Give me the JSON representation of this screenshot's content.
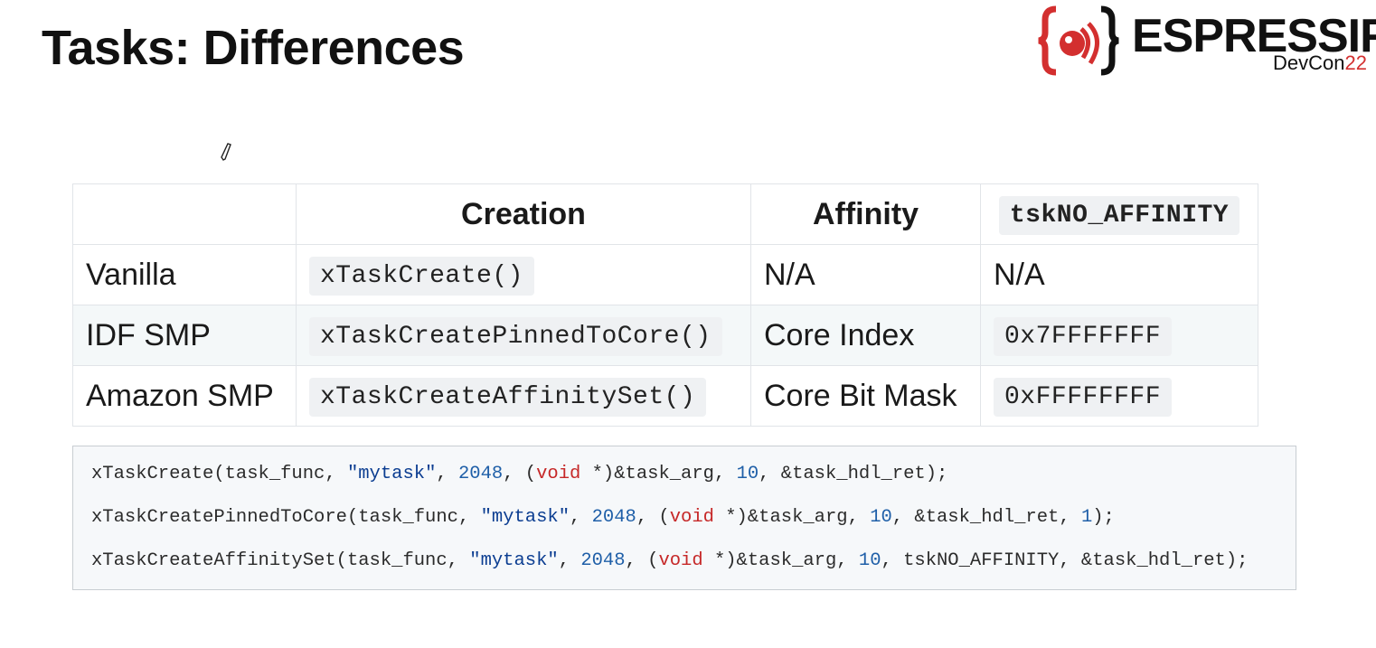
{
  "slide": {
    "title": "Tasks: Differences"
  },
  "logo": {
    "name": "ESPRESSIF",
    "event": "DevCon",
    "year": "22"
  },
  "table": {
    "headers": [
      "",
      "Creation",
      "Affinity",
      "tskNO_AFFINITY"
    ],
    "rows": [
      {
        "label": "Vanilla",
        "creation": "xTaskCreate()",
        "affinity": "N/A",
        "no_affinity": "N/A"
      },
      {
        "label": "IDF SMP",
        "creation": "xTaskCreatePinnedToCore()",
        "affinity": "Core Index",
        "no_affinity": "0x7FFFFFFF"
      },
      {
        "label": "Amazon SMP",
        "creation": "xTaskCreateAffinitySet()",
        "affinity": "Core Bit Mask",
        "no_affinity": "0xFFFFFFFF"
      }
    ]
  },
  "code": {
    "line1": {
      "fn": "xTaskCreate(task_func, ",
      "str": "\"mytask\"",
      "sep1": ", ",
      "n1": "2048",
      "sep2": ", (",
      "kw": "void",
      "sep3": " *)&task_arg, ",
      "n2": "10",
      "tail": ", &task_hdl_ret);"
    },
    "line2": {
      "fn": "xTaskCreatePinnedToCore(task_func, ",
      "str": "\"mytask\"",
      "sep1": ", ",
      "n1": "2048",
      "sep2": ", (",
      "kw": "void",
      "sep3": " *)&task_arg, ",
      "n2": "10",
      "mid": ", &task_hdl_ret, ",
      "n3": "1",
      "tail": ");"
    },
    "line3": {
      "fn": "xTaskCreateAffinitySet(task_func, ",
      "str": "\"mytask\"",
      "sep1": ", ",
      "n1": "2048",
      "sep2": ", (",
      "kw": "void",
      "sep3": " *)&task_arg, ",
      "n2": "10",
      "tail": ", tskNO_AFFINITY, &task_hdl_ret);"
    }
  },
  "colors": {
    "string": "#0b3d91",
    "number": "#1f5fa8",
    "keyword": "#c62828",
    "logo_accent": "#d32f2f"
  },
  "icons": {
    "logo": "espressif-logo-icon",
    "cursor": "pen-cursor-icon"
  }
}
